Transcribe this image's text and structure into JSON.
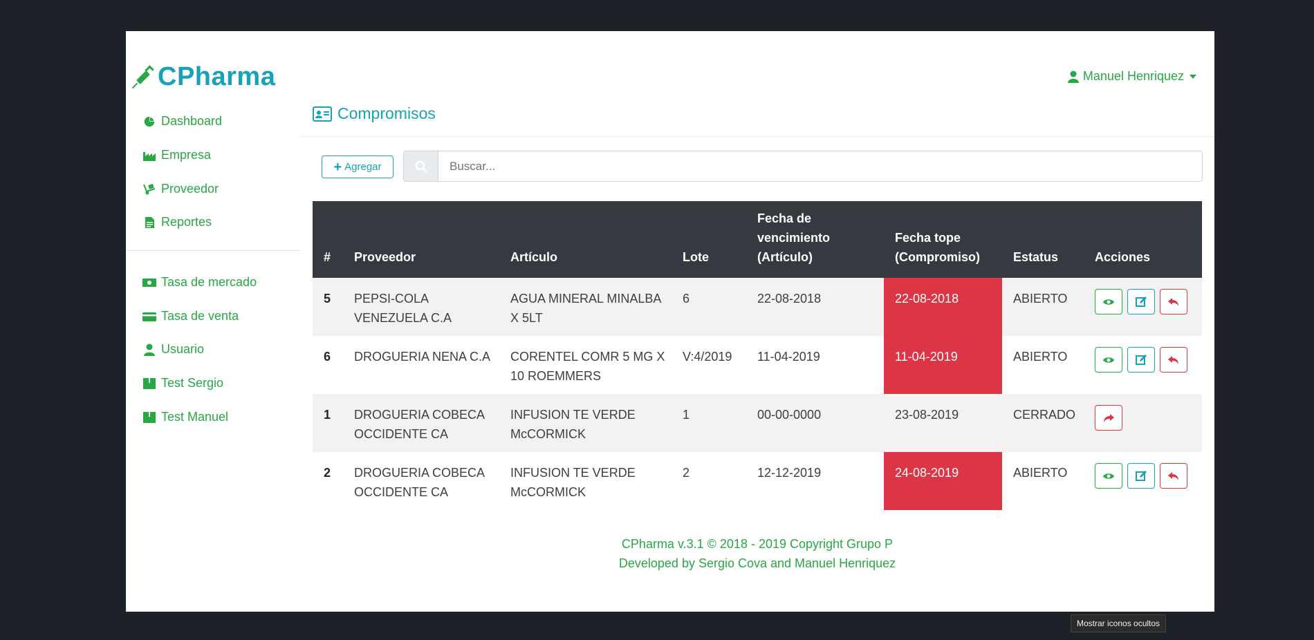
{
  "brand": {
    "name": "CPharma"
  },
  "user": {
    "name": "Manuel Henriquez"
  },
  "sidebar": {
    "items": [
      {
        "label": "Dashboard",
        "icon": "pie-chart-icon"
      },
      {
        "label": "Empresa",
        "icon": "industry-icon"
      },
      {
        "label": "Proveedor",
        "icon": "dolly-icon"
      },
      {
        "label": "Reportes",
        "icon": "file-icon"
      },
      {
        "label": "Tasa de mercado",
        "icon": "money-bill-icon"
      },
      {
        "label": "Tasa de venta",
        "icon": "credit-card-icon"
      },
      {
        "label": "Usuario",
        "icon": "user-icon"
      },
      {
        "label": "Test Sergio",
        "icon": "box-icon"
      },
      {
        "label": "Test Manuel",
        "icon": "box-icon"
      }
    ]
  },
  "page": {
    "title": "Compromisos"
  },
  "toolbar": {
    "add_label": "Agregar",
    "search_placeholder": "Buscar..."
  },
  "table": {
    "headers": [
      "#",
      "Proveedor",
      "Artículo",
      "Lote",
      "Fecha de vencimiento (Artículo)",
      "Fecha tope (Compromiso)",
      "Estatus",
      "Acciones"
    ],
    "rows": [
      {
        "num": "5",
        "proveedor": "PEPSI-COLA VENEZUELA C.A",
        "articulo": "AGUA MINERAL MINALBA X 5LT",
        "lote": "6",
        "vencimiento": "22-08-2018",
        "tope": "22-08-2018",
        "estatus": "ABIERTO"
      },
      {
        "num": "6",
        "proveedor": "DROGUERIA NENA C.A",
        "articulo": "CORENTEL COMR 5 MG X 10 ROEMMERS",
        "lote": "V:4/2019",
        "vencimiento": "11-04-2019",
        "tope": "11-04-2019",
        "estatus": "ABIERTO"
      },
      {
        "num": "1",
        "proveedor": "DROGUERIA COBECA OCCIDENTE CA",
        "articulo": "INFUSION TE VERDE McCORMICK",
        "lote": "1",
        "vencimiento": "00-00-0000",
        "tope": "23-08-2019",
        "estatus": "CERRADO"
      },
      {
        "num": "2",
        "proveedor": "DROGUERIA COBECA OCCIDENTE CA",
        "articulo": "INFUSION TE VERDE McCORMICK",
        "lote": "2",
        "vencimiento": "12-12-2019",
        "tope": "24-08-2019",
        "estatus": "ABIERTO"
      }
    ]
  },
  "footer": {
    "line1": "CPharma v.3.1 © 2018 - 2019 Copyright Grupo P",
    "line2": "Developed by Sergio Cova and Manuel Henriquez"
  },
  "tooltip": {
    "text": "Mostrar iconos ocultos"
  },
  "colors": {
    "primary": "#17a2b8",
    "success": "#28a745",
    "danger": "#dc3545",
    "header": "#343a40"
  }
}
